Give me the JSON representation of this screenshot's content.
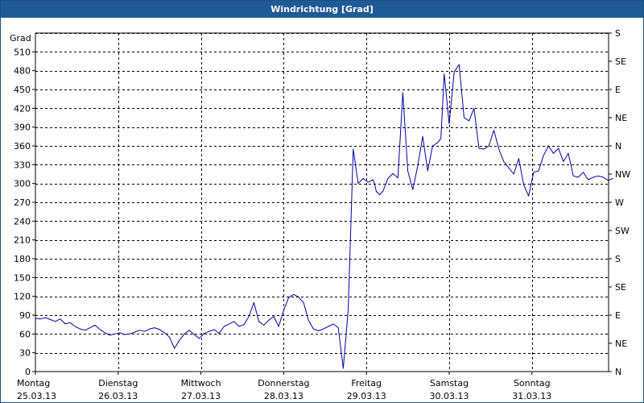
{
  "window": {
    "title": "Windrichtung [Grad]"
  },
  "chart_data": {
    "type": "line",
    "title": "Windrichtung [Grad]",
    "ylabel": "Grad",
    "ylim": [
      0,
      540
    ],
    "grid": true,
    "y_ticks": [
      0,
      30,
      60,
      90,
      120,
      150,
      180,
      210,
      240,
      270,
      300,
      330,
      360,
      390,
      420,
      450,
      480,
      510
    ],
    "y2_labels": [
      "N",
      "NE",
      "E",
      "SE",
      "S",
      "SW",
      "W",
      "NW",
      "N",
      "NE",
      "E",
      "SE",
      "S"
    ],
    "x_labels": [
      {
        "day": "Montag",
        "date": "25.03.13"
      },
      {
        "day": "Dienstag",
        "date": "26.03.13"
      },
      {
        "day": "Mittwoch",
        "date": "27.03.13"
      },
      {
        "day": "Donnerstag",
        "date": "28.03.13"
      },
      {
        "day": "Freitag",
        "date": "29.03.13"
      },
      {
        "day": "Samstag",
        "date": "30.03.13"
      },
      {
        "day": "Sonntag",
        "date": "31.03.13"
      }
    ],
    "x_unit": "days since Montag 25.03.13 00:00",
    "xlim": [
      0,
      7
    ],
    "series": [
      {
        "name": "Windrichtung",
        "color": "#0000a0",
        "x": [
          0.0,
          0.06,
          0.12,
          0.18,
          0.24,
          0.3,
          0.36,
          0.42,
          0.48,
          0.54,
          0.6,
          0.66,
          0.72,
          0.78,
          0.84,
          0.9,
          0.96,
          1.02,
          1.08,
          1.14,
          1.2,
          1.26,
          1.32,
          1.38,
          1.44,
          1.5,
          1.56,
          1.62,
          1.68,
          1.74,
          1.8,
          1.86,
          1.92,
          1.98,
          2.04,
          2.1,
          2.16,
          2.22,
          2.28,
          2.34,
          2.4,
          2.46,
          2.52,
          2.58,
          2.64,
          2.7,
          2.76,
          2.82,
          2.88,
          2.94,
          3.0,
          3.06,
          3.12,
          3.18,
          3.24,
          3.3,
          3.36,
          3.42,
          3.48,
          3.54,
          3.6,
          3.66,
          3.72,
          3.78,
          3.84,
          3.9,
          3.96,
          4.02,
          4.08,
          4.1,
          4.12,
          4.14,
          4.16,
          4.2,
          4.26,
          4.32,
          4.38,
          4.44,
          4.5,
          4.56,
          4.62,
          4.68,
          4.74,
          4.8,
          4.86,
          4.9,
          4.94,
          5.0,
          5.06,
          5.12,
          5.18,
          5.24,
          5.3,
          5.36,
          5.42,
          5.48,
          5.54,
          5.6,
          5.66,
          5.72,
          5.78,
          5.84,
          5.9,
          5.96,
          6.02,
          6.08,
          6.14,
          6.2,
          6.26,
          6.32,
          6.38,
          6.44,
          6.5,
          6.56,
          6.62,
          6.68,
          6.74,
          6.8,
          6.86,
          6.92,
          6.98
        ],
        "y": [
          85,
          84,
          86,
          83,
          80,
          84,
          76,
          78,
          72,
          68,
          66,
          70,
          74,
          67,
          62,
          58,
          60,
          62,
          59,
          60,
          63,
          66,
          64,
          68,
          70,
          67,
          62,
          55,
          37,
          50,
          60,
          66,
          59,
          53,
          61,
          64,
          67,
          61,
          72,
          76,
          80,
          72,
          75,
          88,
          110,
          80,
          74,
          82,
          88,
          72,
          98,
          118,
          123,
          119,
          110,
          82,
          68,
          65,
          68,
          72,
          76,
          70,
          5,
          100,
          355,
          300,
          308,
          302,
          306,
          298,
          287,
          285,
          282,
          288,
          308,
          316,
          309,
          445,
          320,
          290,
          328,
          375,
          320,
          360,
          365,
          372,
          475,
          395,
          478,
          490,
          405,
          400,
          420,
          356,
          355,
          360,
          385,
          355,
          335,
          325,
          315,
          340,
          298,
          280,
          318,
          320,
          345,
          360,
          348,
          356,
          335,
          348,
          312,
          310,
          318,
          306,
          310,
          312,
          310,
          305,
          308
        ]
      }
    ]
  }
}
